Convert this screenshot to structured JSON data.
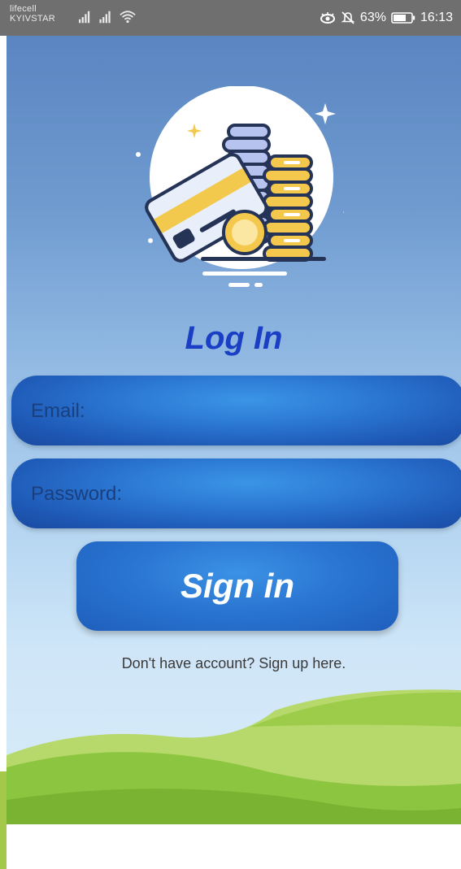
{
  "status_bar": {
    "carrier_1": "lifecell",
    "carrier_2": "KYIVSTAR",
    "battery": "63%",
    "time": "16:13",
    "icons": [
      "signal-icon",
      "signal-icon",
      "wifi-icon",
      "eye-icon",
      "bell-off-icon",
      "battery-icon"
    ]
  },
  "screen": {
    "title": "Log In",
    "email_placeholder": "Email:",
    "password_placeholder": "Password:",
    "signin_label": "Sign in",
    "signup_text": "Don't have account? Sign up here."
  },
  "colors": {
    "title": "#1b3fc4",
    "field": "#2b78d3",
    "button": "#2a76d2",
    "hills": "#8cc53f"
  }
}
